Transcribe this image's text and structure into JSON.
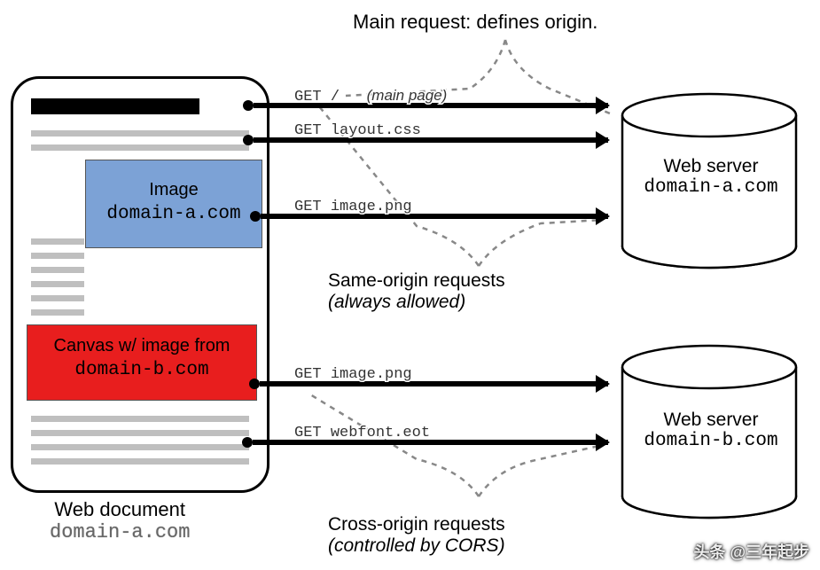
{
  "title": "Main request: defines origin.",
  "document": {
    "caption_line1": "Web document",
    "caption_line2": "domain-a.com",
    "image_box": {
      "line1": "Image",
      "line2": "domain-a.com"
    },
    "canvas_box": {
      "line1": "Canvas w/ image from",
      "line2": "domain-b.com"
    }
  },
  "requests": {
    "r1": {
      "method": "GET",
      "path": "/",
      "note": "(main page)"
    },
    "r2": {
      "method": "GET",
      "path": "layout.css"
    },
    "r3": {
      "method": "GET",
      "path": "image.png"
    },
    "r4": {
      "method": "GET",
      "path": "image.png"
    },
    "r5": {
      "method": "GET",
      "path": "webfont.eot"
    }
  },
  "groups": {
    "same": {
      "line1": "Same-origin requests",
      "line2": "(always allowed)"
    },
    "cross": {
      "line1": "Cross-origin requests",
      "line2": "(controlled by CORS)"
    }
  },
  "servers": {
    "a": {
      "line1": "Web server",
      "line2": "domain-a.com"
    },
    "b": {
      "line1": "Web server",
      "line2": "domain-b.com"
    }
  },
  "watermark": "头条 @三年起步"
}
